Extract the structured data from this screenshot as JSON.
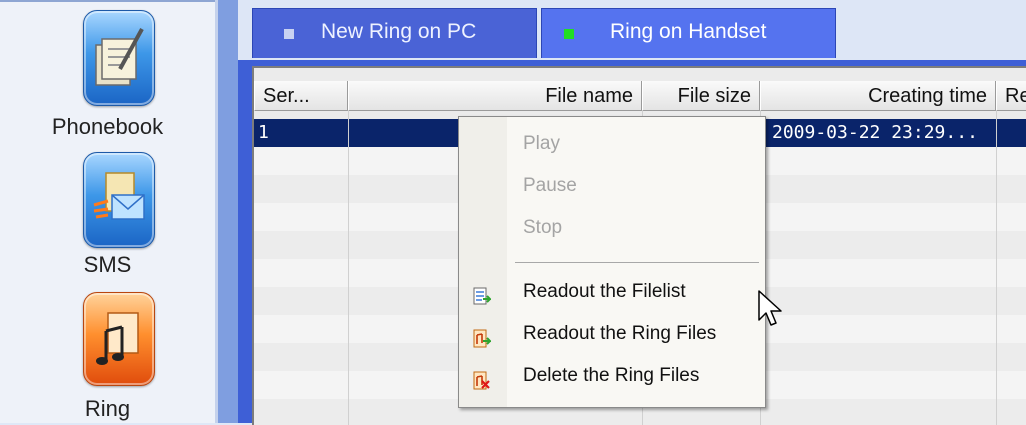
{
  "sidebar": {
    "items": [
      {
        "label": "Phonebook",
        "icon": "phonebook-icon"
      },
      {
        "label": "SMS",
        "icon": "sms-icon"
      },
      {
        "label": "Ring",
        "icon": "ring-icon",
        "active": true
      }
    ]
  },
  "tabs": [
    {
      "label": "New Ring on PC",
      "active": false
    },
    {
      "label": "Ring on Handset",
      "active": true
    }
  ],
  "table": {
    "columns": [
      "Ser...",
      "File name",
      "File size",
      "Creating time",
      "Re"
    ],
    "rows": [
      {
        "serial": "1",
        "file_name": "",
        "file_size": "",
        "creating_time": "2009-03-22 23:29...",
        "selected": true
      }
    ]
  },
  "context_menu": {
    "items": [
      {
        "label": "Play",
        "enabled": false
      },
      {
        "label": "Pause",
        "enabled": false
      },
      {
        "label": "Stop",
        "enabled": false
      },
      {
        "label": "Readout the Filelist",
        "enabled": true,
        "icon": "readout-filelist-icon"
      },
      {
        "label": "Readout the Ring Files",
        "enabled": true,
        "icon": "readout-ring-files-icon"
      },
      {
        "label": "Delete the Ring Files",
        "enabled": true,
        "icon": "delete-ring-files-icon"
      }
    ]
  },
  "colors": {
    "selection": "#0a246a",
    "tab_active": "#5573ef",
    "tab_inactive": "#4a63d6",
    "active_dot": "#22dd22",
    "ring_icon": "#ff8f2e"
  }
}
